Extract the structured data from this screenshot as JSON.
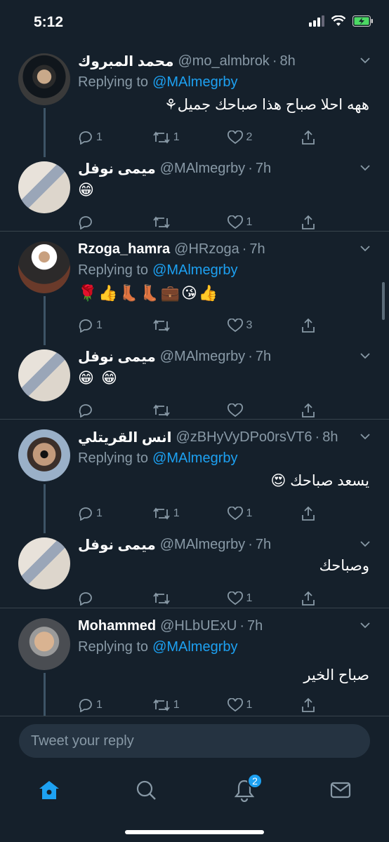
{
  "status_bar": {
    "time": "5:12"
  },
  "tweets": [
    {
      "display_name": "محمد المبروك",
      "handle": "@mo_almbrok",
      "time": "8h",
      "replying_prefix": "Replying to",
      "replying_to": "@MAlmegrby",
      "text": "ههه احلا صباح هذا صباحك جميل⚘",
      "counts": {
        "reply": "1",
        "retweet": "1",
        "like": "2"
      }
    },
    {
      "display_name": "ميمى نوفل",
      "handle": "@MAlmegrby",
      "time": "7h",
      "text": "😁",
      "counts": {
        "reply": "",
        "retweet": "",
        "like": "1"
      }
    },
    {
      "display_name": "Rzoga_hamra",
      "handle": "@HRzoga",
      "time": "7h",
      "replying_prefix": "Replying to",
      "replying_to": "@MAlmegrby",
      "text": "🌹👍👢👢💼😘👍",
      "counts": {
        "reply": "1",
        "retweet": "",
        "like": "3"
      }
    },
    {
      "display_name": "ميمى نوفل",
      "handle": "@MAlmegrby",
      "time": "7h",
      "text": "😁 😁",
      "counts": {
        "reply": "",
        "retweet": "",
        "like": ""
      }
    },
    {
      "display_name": "انس القريتلي",
      "handle": "@zBHyVyDPo0rsVT6",
      "time": "8h",
      "replying_prefix": "Replying to",
      "replying_to": "@MAlmegrby",
      "text": "يسعد صباحك 😍",
      "counts": {
        "reply": "1",
        "retweet": "1",
        "like": "1"
      }
    },
    {
      "display_name": "ميمى نوفل",
      "handle": "@MAlmegrby",
      "time": "7h",
      "text": "وصباحك",
      "counts": {
        "reply": "",
        "retweet": "",
        "like": "1"
      }
    },
    {
      "display_name": "Mohammed",
      "handle": "@HLbUExU",
      "time": "7h",
      "replying_prefix": "Replying to",
      "replying_to": "@MAlmegrby",
      "text": "صباح الخير",
      "counts": {
        "reply": "1",
        "retweet": "1",
        "like": "1"
      }
    }
  ],
  "separator": "·",
  "reply_bar": {
    "placeholder": "Tweet your reply"
  },
  "tab_bar": {
    "notifications_badge": "2"
  },
  "colors": {
    "background": "#15202b",
    "accent": "#1da1f2",
    "secondary_text": "#8899a6",
    "divider": "#38444d"
  },
  "icons": [
    "reply-icon",
    "retweet-icon",
    "like-icon",
    "share-icon",
    "home-icon",
    "search-icon",
    "notifications-icon",
    "messages-icon",
    "caret-down-icon"
  ]
}
